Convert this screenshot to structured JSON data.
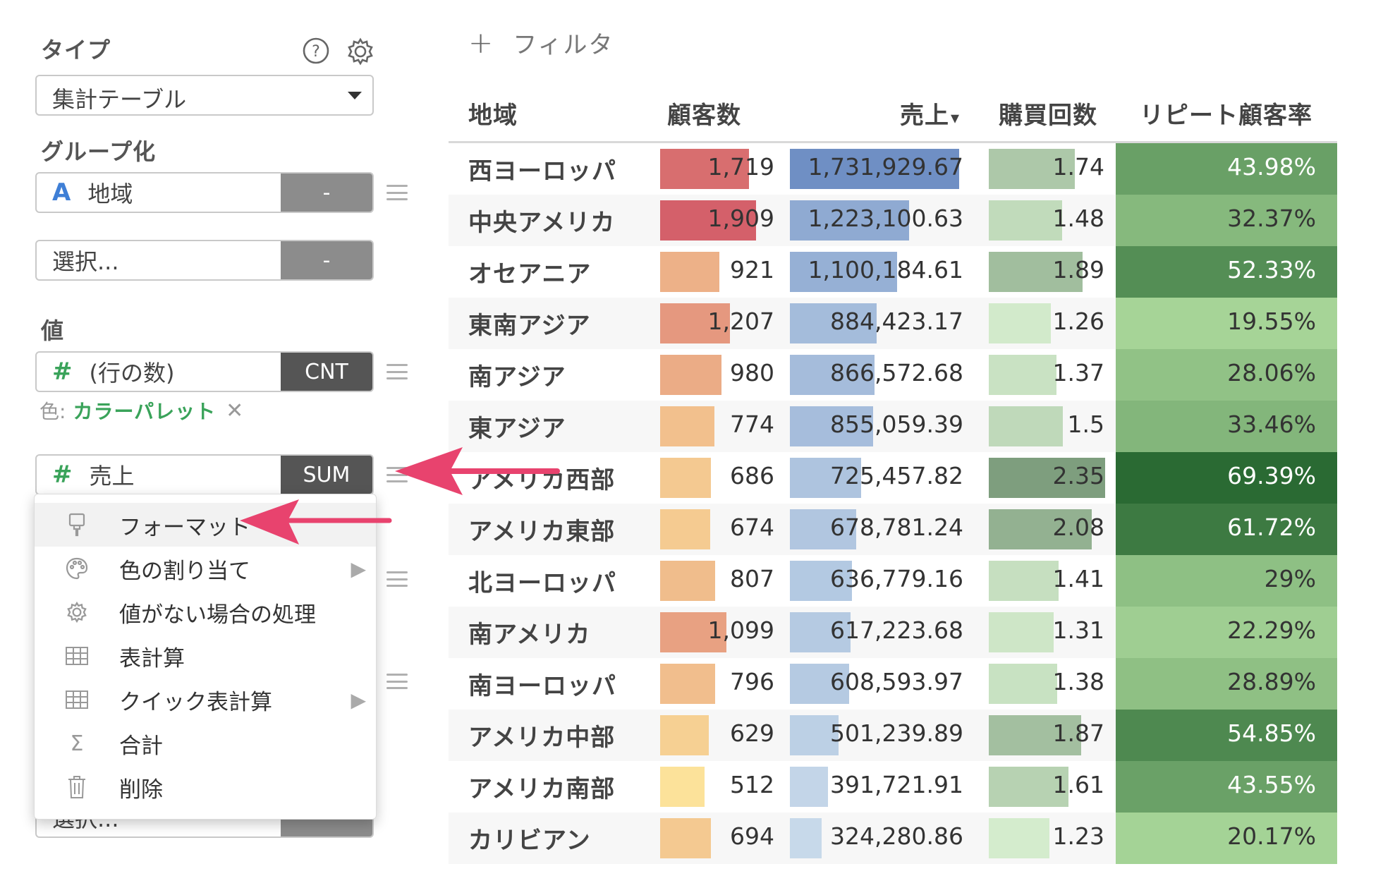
{
  "panel": {
    "type_label": "タイプ",
    "type_value": "集計テーブル",
    "group_label": "グループ化",
    "group_field": "地域",
    "group_field_type": "A",
    "group_agg": "-",
    "group_select_placeholder": "選択...",
    "group_select_agg": "-",
    "value_label": "値",
    "value1_field": "(行の数)",
    "value1_agg": "CNT",
    "color_prefix": "色:",
    "color_value": "カラーパレット",
    "value2_field": "売上",
    "value2_agg": "SUM",
    "bottom_select_placeholder": "選択...",
    "bottom_select_agg": "-"
  },
  "icons": {
    "help": "help-icon",
    "settings": "gear-icon",
    "dropdown": "chevron-down-icon",
    "drag": "drag-handle-icon",
    "remove": "close-icon"
  },
  "menu": {
    "items": [
      {
        "label": "フォーマット",
        "icon": "brush-icon",
        "submenu": false
      },
      {
        "label": "色の割り当て",
        "icon": "palette-icon",
        "submenu": true
      },
      {
        "label": "値がない場合の処理",
        "icon": "gear-icon",
        "submenu": false
      },
      {
        "label": "表計算",
        "icon": "table-icon",
        "submenu": false
      },
      {
        "label": "クイック表計算",
        "icon": "table-icon",
        "submenu": true
      },
      {
        "label": "合計",
        "icon": "sigma-icon",
        "submenu": false
      },
      {
        "label": "削除",
        "icon": "trash-icon",
        "submenu": false
      }
    ]
  },
  "filter": {
    "label": "フィルタ"
  },
  "table": {
    "headers": {
      "region": "地域",
      "customers": "顧客数",
      "sales": "売上",
      "purchases": "購買回数",
      "repeat": "リピート顧客率"
    },
    "sort_indicator": "▾",
    "rows": [
      {
        "region": "西ヨーロッパ",
        "customers": "1,719",
        "sales": "1,731,929.67",
        "purchases": "1.74",
        "repeat": "43.98%"
      },
      {
        "region": "中央アメリカ",
        "customers": "1,909",
        "sales": "1,223,100.63",
        "purchases": "1.48",
        "repeat": "32.37%"
      },
      {
        "region": "オセアニア",
        "customers": "921",
        "sales": "1,100,184.61",
        "purchases": "1.89",
        "repeat": "52.33%"
      },
      {
        "region": "東南アジア",
        "customers": "1,207",
        "sales": "884,423.17",
        "purchases": "1.26",
        "repeat": "19.55%"
      },
      {
        "region": "南アジア",
        "customers": "980",
        "sales": "866,572.68",
        "purchases": "1.37",
        "repeat": "28.06%"
      },
      {
        "region": "東アジア",
        "customers": "774",
        "sales": "855,059.39",
        "purchases": "1.5",
        "repeat": "33.46%"
      },
      {
        "region": "アメリカ西部",
        "customers": "686",
        "sales": "725,457.82",
        "purchases": "2.35",
        "repeat": "69.39%"
      },
      {
        "region": "アメリカ東部",
        "customers": "674",
        "sales": "678,781.24",
        "purchases": "2.08",
        "repeat": "61.72%"
      },
      {
        "region": "北ヨーロッパ",
        "customers": "807",
        "sales": "636,779.16",
        "purchases": "1.41",
        "repeat": "29%"
      },
      {
        "region": "南アメリカ",
        "customers": "1,099",
        "sales": "617,223.68",
        "purchases": "1.31",
        "repeat": "22.29%"
      },
      {
        "region": "南ヨーロッパ",
        "customers": "796",
        "sales": "608,593.97",
        "purchases": "1.38",
        "repeat": "28.89%"
      },
      {
        "region": "アメリカ中部",
        "customers": "629",
        "sales": "501,239.89",
        "purchases": "1.87",
        "repeat": "54.85%"
      },
      {
        "region": "アメリカ南部",
        "customers": "512",
        "sales": "391,721.91",
        "purchases": "1.61",
        "repeat": "43.55%"
      },
      {
        "region": "カリビアン",
        "customers": "694",
        "sales": "324,280.86",
        "purchases": "1.23",
        "repeat": "20.17%"
      }
    ]
  },
  "colors": {
    "accent_green": "#3aa35a",
    "arrow_pink": "#e8436e",
    "customers_low": "#fce29a",
    "customers_high": "#d4606a",
    "sales_light": "#c7d9ea",
    "sales_dark": "#6f8fc4",
    "purchases_light": "#d4eccd",
    "purchases_dark": "#7e9e7e",
    "repeat_light": "#a6d497",
    "repeat_dark": "#2a6a33"
  }
}
